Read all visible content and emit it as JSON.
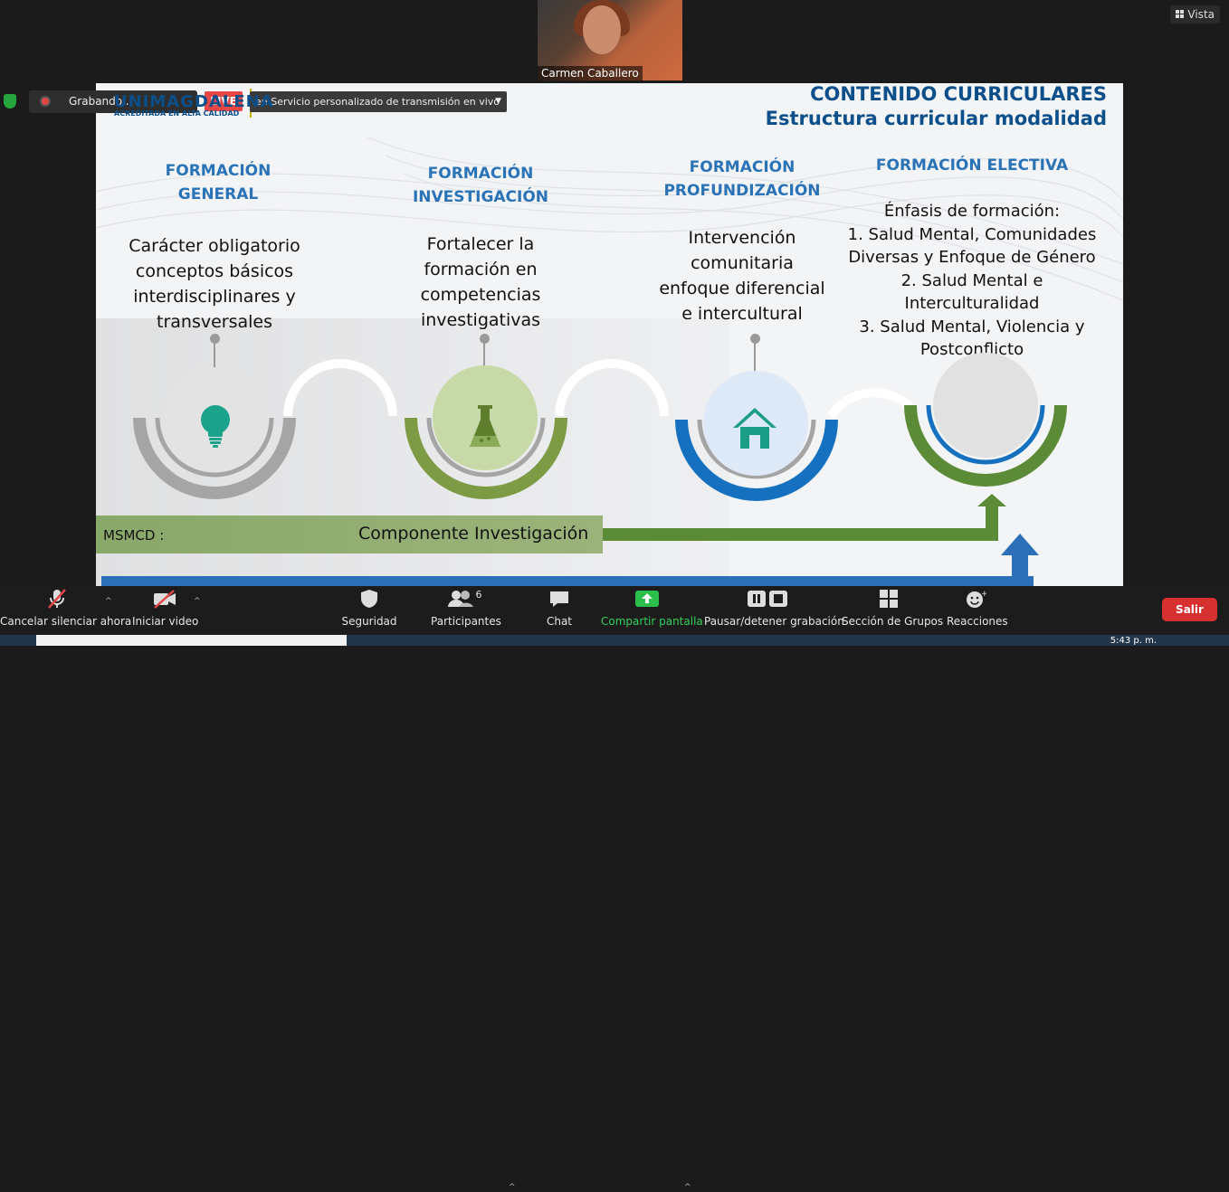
{
  "video": {
    "participant_name": "Carmen Caballero"
  },
  "view_button": {
    "label": "Vista"
  },
  "recording": {
    "label": "Grabando...",
    "live_label": "LIVE",
    "stream_target": "en Servicio personalizado de transmisión en vivo"
  },
  "slide": {
    "logo": {
      "name": "UNIMAGDALENA",
      "tagline": "ACREDITADA EN ALTA CALIDAD"
    },
    "title_line1": "CONTENIDO CURRICULARES",
    "title_line2": "Estructura curricular modalidad",
    "columns": [
      {
        "heading": [
          "FORMACIÓN",
          "GENERAL"
        ],
        "body": [
          "Carácter obligatorio",
          "conceptos básicos",
          "interdisciplinares y",
          "transversales"
        ],
        "icon": "lightbulb-icon"
      },
      {
        "heading": [
          "FORMACIÓN",
          "INVESTIGACIÓN"
        ],
        "body": [
          "Fortalecer la",
          "formación en",
          "competencias",
          "investigativas"
        ],
        "icon": "flask-icon"
      },
      {
        "heading": [
          "FORMACIÓN",
          "PROFUNDIZACIÓN"
        ],
        "body": [
          "Intervención",
          "comunitaria",
          "enfoque diferencial",
          "e intercultural"
        ],
        "icon": "house-icon"
      },
      {
        "heading": [
          "FORMACIÓN ELECTIVA"
        ],
        "body": [
          "Énfasis de formación:",
          "1. Salud Mental, Comunidades",
          "Diversas y Enfoque de Género",
          "2. Salud Mental e",
          "Interculturalidad",
          "3. Salud Mental, Violencia y",
          "Postconflicto"
        ],
        "icon": ""
      }
    ],
    "bar_prefix": "MSMCD :",
    "bar_component": "Componente  Investigación"
  },
  "colors": {
    "gray": "#a5a5a5",
    "green": "#7d9b45",
    "blue": "#1570bf",
    "dark_green": "#5b8b37",
    "teal": "#1aa38a"
  },
  "toolbar": {
    "mute_label": "Cancelar silenciar ahora",
    "video_label": "Iniciar video",
    "security_label": "Seguridad",
    "participants_label": "Participantes",
    "participants_count": "6",
    "chat_label": "Chat",
    "share_label": "Compartir pantalla",
    "record_label": "Pausar/detener grabación",
    "breakout_label": "Sección de Grupos",
    "reactions_label": "Reacciones",
    "leave_label": "Salir"
  },
  "clock": "5:43 p. m."
}
